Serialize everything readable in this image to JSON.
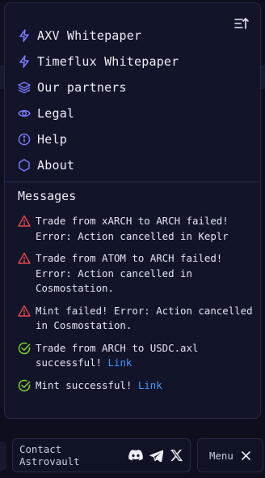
{
  "menu": {
    "items": [
      {
        "label": "AXV Whitepaper",
        "icon": "lightning-icon"
      },
      {
        "label": "Timeflux Whitepaper",
        "icon": "lightning-icon"
      },
      {
        "label": "Our partners",
        "icon": "layers-icon"
      },
      {
        "label": "Legal",
        "icon": "eye-icon"
      },
      {
        "label": "Help",
        "icon": "info-icon"
      },
      {
        "label": "About",
        "icon": "hexagon-icon"
      }
    ]
  },
  "messages": {
    "title": "Messages",
    "items": [
      {
        "status": "error",
        "text": "Trade from xARCH to ARCH failed!\nError: Action cancelled in Keplr",
        "link": ""
      },
      {
        "status": "error",
        "text": "Trade from ATOM to ARCH failed!\nError: Action cancelled in\nCosmostation.",
        "link": ""
      },
      {
        "status": "error",
        "text": "Mint failed! Error: Action cancelled\nin Cosmostation.",
        "link": ""
      },
      {
        "status": "success",
        "text": "Trade from ARCH to USDC.axl\nsuccessful! ",
        "link": "Link"
      },
      {
        "status": "success",
        "text": "Mint successful! ",
        "link": "Link"
      }
    ]
  },
  "footer": {
    "contact_label": "Contact Astrovault",
    "menu_label": "Menu"
  },
  "colors": {
    "accent": "#7b7bff",
    "error": "#e5484d",
    "success": "#7ed321",
    "link": "#3f9bff"
  }
}
